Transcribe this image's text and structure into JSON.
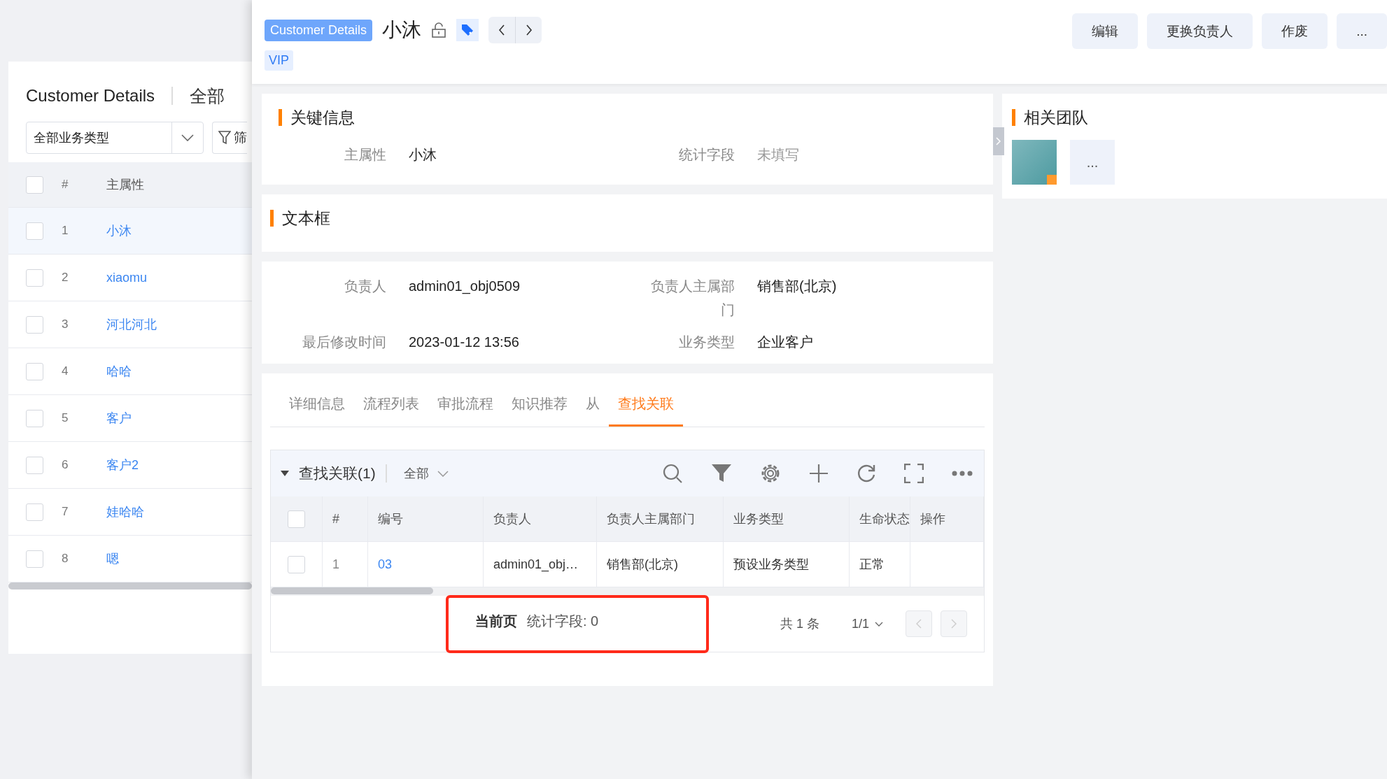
{
  "list_panel": {
    "title": "Customer Details",
    "view": "全部",
    "type_select": "全部业务类型",
    "filter_button": "筛",
    "columns": [
      "#",
      "主属性"
    ],
    "header_checked": false,
    "rows": [
      {
        "index": "1",
        "name": "小沐",
        "selected": true,
        "checked": false
      },
      {
        "index": "2",
        "name": "xiaomu",
        "selected": false,
        "checked": false
      },
      {
        "index": "3",
        "name": "河北河北",
        "selected": false,
        "checked": false
      },
      {
        "index": "4",
        "name": "哈哈",
        "selected": false,
        "checked": false
      },
      {
        "index": "5",
        "name": "客户",
        "selected": false,
        "checked": false
      },
      {
        "index": "6",
        "name": "客户2",
        "selected": false,
        "checked": false
      },
      {
        "index": "7",
        "name": "娃哈哈",
        "selected": false,
        "checked": false
      },
      {
        "index": "8",
        "name": "嗯",
        "selected": false,
        "checked": false
      }
    ]
  },
  "detail": {
    "object_tag": "Customer Details",
    "title": "小沐",
    "tags": [
      "VIP"
    ],
    "actions": [
      "编辑",
      "更换负责人",
      "作废",
      "..."
    ],
    "key_info": {
      "title": "关键信息",
      "fields": [
        {
          "label": "主属性",
          "value": "小沐",
          "empty": false
        },
        {
          "label": "统计字段",
          "value": "未填写",
          "empty": true
        }
      ]
    },
    "text_section": {
      "title": "文本框"
    },
    "info_fields": [
      {
        "label": "负责人",
        "value": "admin01_obj0509"
      },
      {
        "label": "负责人主属部门",
        "value": "销售部(北京)"
      },
      {
        "label": "最后修改时间",
        "value": "2023-01-12 13:56"
      },
      {
        "label": "业务类型",
        "value": "企业客户"
      }
    ],
    "tabs": [
      {
        "label": "详细信息",
        "selected": false
      },
      {
        "label": "流程列表",
        "selected": false
      },
      {
        "label": "审批流程",
        "selected": false
      },
      {
        "label": "知识推荐",
        "selected": false
      },
      {
        "label": "从",
        "selected": false
      },
      {
        "label": "查找关联",
        "selected": true
      }
    ],
    "related_list": {
      "title": "查找关联(1)",
      "expanded": true,
      "scope": "全部",
      "columns": [
        "#",
        "编号",
        "负责人",
        "负责人主属部门",
        "业务类型",
        "生命状态",
        "操作"
      ],
      "header_checked": false,
      "rows": [
        {
          "checked": false,
          "cells": [
            "1",
            "03",
            "admin01_obj…",
            "销售部(北京)",
            "预设业务类型",
            "正常"
          ]
        }
      ],
      "summary_label": "当前页",
      "summary_value": "统计字段: 0",
      "total": "共 1 条",
      "page": "1/1"
    },
    "team": {
      "title": "相关团队",
      "more": "..."
    }
  }
}
